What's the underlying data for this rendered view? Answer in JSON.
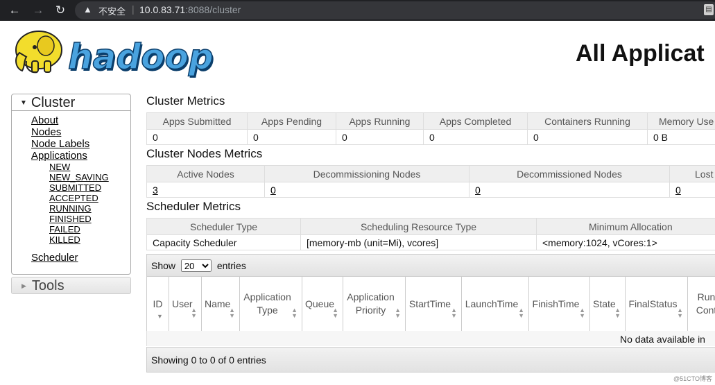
{
  "browser": {
    "security_text": "不安全",
    "url_host": "10.0.83.71",
    "url_rest": ":8088/cluster"
  },
  "header": {
    "title": "All Applicat"
  },
  "nav": {
    "cluster_label": "Cluster",
    "links": [
      "About",
      "Nodes",
      "Node Labels",
      "Applications"
    ],
    "app_states": [
      "NEW",
      "NEW_SAVING",
      "SUBMITTED",
      "ACCEPTED",
      "RUNNING",
      "FINISHED",
      "FAILED",
      "KILLED"
    ],
    "scheduler": "Scheduler",
    "tools_label": "Tools"
  },
  "cluster_metrics": {
    "title": "Cluster Metrics",
    "headers": [
      "Apps Submitted",
      "Apps Pending",
      "Apps Running",
      "Apps Completed",
      "Containers Running",
      "Memory Use"
    ],
    "values": [
      "0",
      "0",
      "0",
      "0",
      "0",
      "0 B"
    ]
  },
  "nodes_metrics": {
    "title": "Cluster Nodes Metrics",
    "headers": [
      "Active Nodes",
      "Decommissioning Nodes",
      "Decommissioned Nodes",
      "Lost"
    ],
    "values": [
      "3",
      "0",
      "0",
      "0"
    ]
  },
  "scheduler_metrics": {
    "title": "Scheduler Metrics",
    "headers": [
      "Scheduler Type",
      "Scheduling Resource Type",
      "Minimum Allocation"
    ],
    "values": [
      "Capacity Scheduler",
      "[memory-mb (unit=Mi), vcores]",
      "<memory:1024, vCores:1>"
    ]
  },
  "apps": {
    "show_label": "Show",
    "page_size": "20",
    "entries_label": "entries",
    "columns": [
      {
        "l1": "ID",
        "l2": ""
      },
      {
        "l1": "User",
        "l2": ""
      },
      {
        "l1": "Name",
        "l2": ""
      },
      {
        "l1": "Application",
        "l2": "Type"
      },
      {
        "l1": "Queue",
        "l2": ""
      },
      {
        "l1": "Application",
        "l2": "Priority"
      },
      {
        "l1": "StartTime",
        "l2": ""
      },
      {
        "l1": "LaunchTime",
        "l2": ""
      },
      {
        "l1": "FinishTime",
        "l2": ""
      },
      {
        "l1": "State",
        "l2": ""
      },
      {
        "l1": "FinalStatus",
        "l2": ""
      },
      {
        "l1": "Run",
        "l2": "Cont"
      }
    ],
    "empty_text": "No data available in",
    "footer_text": "Showing 0 to 0 of 0 entries"
  },
  "watermark": "@51CTO博客"
}
